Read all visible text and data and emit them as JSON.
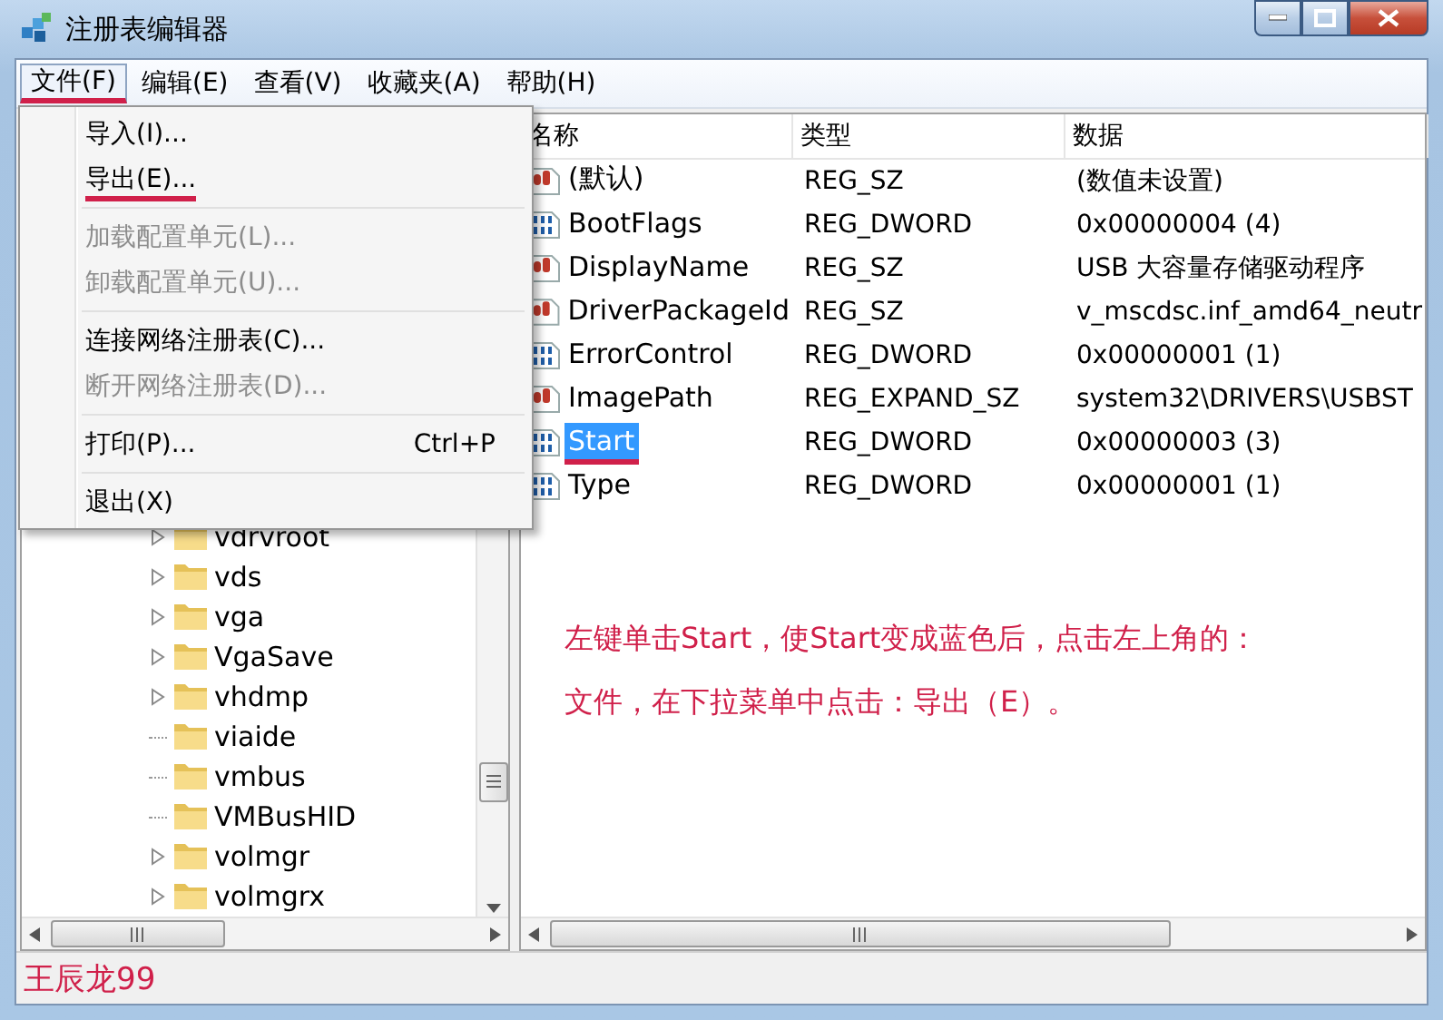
{
  "window": {
    "title": "注册表编辑器"
  },
  "menu_bar": [
    {
      "label": "文件(F)",
      "selected": true,
      "annotated": true
    },
    {
      "label": "编辑(E)",
      "selected": false,
      "annotated": false
    },
    {
      "label": "查看(V)",
      "selected": false,
      "annotated": false
    },
    {
      "label": "收藏夹(A)",
      "selected": false,
      "annotated": false
    },
    {
      "label": "帮助(H)",
      "selected": false,
      "annotated": false
    }
  ],
  "file_menu": {
    "items": [
      {
        "kind": "item",
        "label": "导入(I)...",
        "disabled": false,
        "annotated": false
      },
      {
        "kind": "item",
        "label": "导出(E)...",
        "disabled": false,
        "annotated": true
      },
      {
        "kind": "separator"
      },
      {
        "kind": "item",
        "label": "加载配置单元(L)...",
        "disabled": true,
        "annotated": false
      },
      {
        "kind": "item",
        "label": "卸载配置单元(U)...",
        "disabled": true,
        "annotated": false
      },
      {
        "kind": "separator"
      },
      {
        "kind": "item",
        "label": "连接网络注册表(C)...",
        "disabled": false,
        "annotated": false
      },
      {
        "kind": "item",
        "label": "断开网络注册表(D)...",
        "disabled": true,
        "annotated": false
      },
      {
        "kind": "separator"
      },
      {
        "kind": "item",
        "label": "打印(P)...",
        "shortcut": "Ctrl+P",
        "disabled": false,
        "annotated": false
      },
      {
        "kind": "separator"
      },
      {
        "kind": "item",
        "label": "退出(X)",
        "disabled": false,
        "annotated": false
      }
    ]
  },
  "tree": {
    "items": [
      {
        "label": "vdrvroot",
        "expandable": true
      },
      {
        "label": "vds",
        "expandable": true
      },
      {
        "label": "vga",
        "expandable": true
      },
      {
        "label": "VgaSave",
        "expandable": true
      },
      {
        "label": "vhdmp",
        "expandable": true
      },
      {
        "label": "viaide",
        "expandable": false
      },
      {
        "label": "vmbus",
        "expandable": false
      },
      {
        "label": "VMBusHID",
        "expandable": false
      },
      {
        "label": "volmgr",
        "expandable": true
      },
      {
        "label": "volmgrx",
        "expandable": true
      }
    ]
  },
  "table": {
    "columns": [
      "名称",
      "类型",
      "数据"
    ],
    "rows": [
      {
        "kind": "string",
        "name": "(默认)",
        "type": "REG_SZ",
        "data": "(数值未设置)",
        "selected": false,
        "annotated": false
      },
      {
        "kind": "binary",
        "name": "BootFlags",
        "type": "REG_DWORD",
        "data": "0x00000004 (4)",
        "selected": false,
        "annotated": false
      },
      {
        "kind": "string",
        "name": "DisplayName",
        "type": "REG_SZ",
        "data": "USB 大容量存储驱动程序",
        "selected": false,
        "annotated": false
      },
      {
        "kind": "string",
        "name": "DriverPackageId",
        "type": "REG_SZ",
        "data": "v_mscdsc.inf_amd64_neutr",
        "selected": false,
        "annotated": false
      },
      {
        "kind": "binary",
        "name": "ErrorControl",
        "type": "REG_DWORD",
        "data": "0x00000001 (1)",
        "selected": false,
        "annotated": false
      },
      {
        "kind": "string",
        "name": "ImagePath",
        "type": "REG_EXPAND_SZ",
        "data": "system32\\DRIVERS\\USBST",
        "selected": false,
        "annotated": false
      },
      {
        "kind": "binary",
        "name": "Start",
        "type": "REG_DWORD",
        "data": "0x00000003 (3)",
        "selected": true,
        "annotated": true
      },
      {
        "kind": "binary",
        "name": "Type",
        "type": "REG_DWORD",
        "data": "0x00000001 (1)",
        "selected": false,
        "annotated": false
      }
    ]
  },
  "annotation": {
    "lines": [
      "左键单击Start，使Start变成蓝色后，点击左上角的：",
      "文件，在下拉菜单中点击：导出（E）。"
    ]
  },
  "status_bar": {
    "text": "王辰龙99"
  }
}
